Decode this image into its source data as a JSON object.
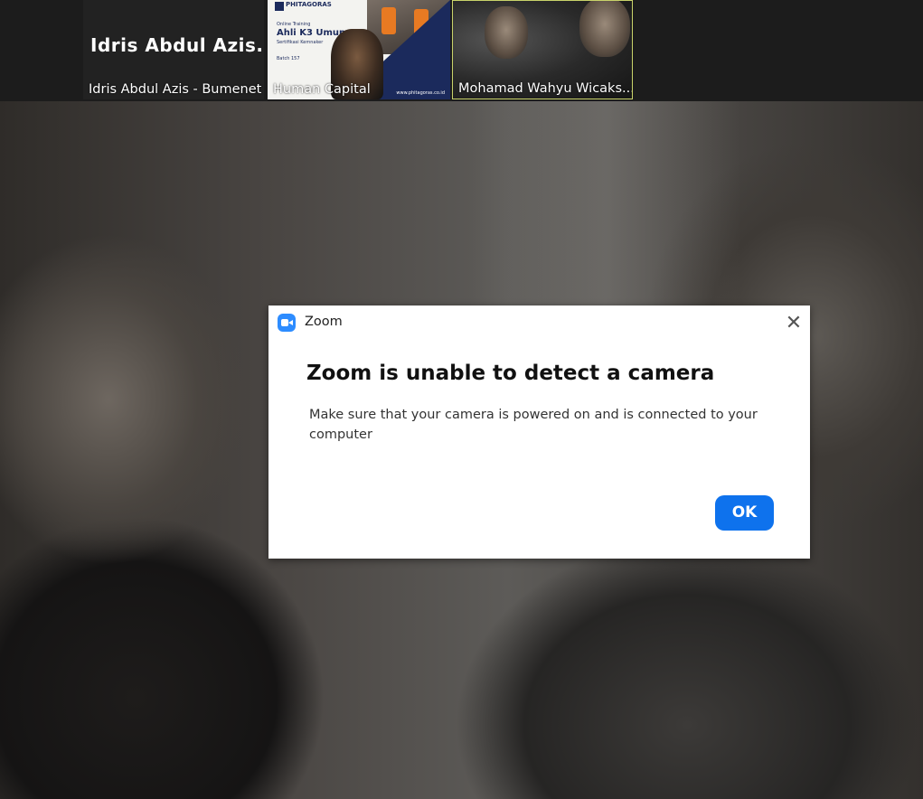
{
  "participants": [
    {
      "display_name": "Idris Abdul Azis...",
      "label": "Idris Abdul Azis - Bumenet"
    },
    {
      "label": "Human Capital"
    },
    {
      "label": "Mohamad Wahyu Wicaks..."
    }
  ],
  "thumbnail_poster": {
    "brand": "PHITAGORAS",
    "line1": "Online Training",
    "title": "Ahli K3 Umum",
    "line2": "Sertifikasi Kemnaker",
    "batch": "Batch 157",
    "site": "www.phitagoras.co.id"
  },
  "dialog": {
    "app_title": "Zoom",
    "heading": "Zoom is unable to detect a camera",
    "message": "Make sure that your camera is powered on and is connected to your computer",
    "ok_label": "OK",
    "close_glyph": "✕"
  },
  "colors": {
    "accent": "#0e72ed",
    "zoom_icon": "#2d8cff",
    "active_speaker_border": "#c9d36a"
  }
}
